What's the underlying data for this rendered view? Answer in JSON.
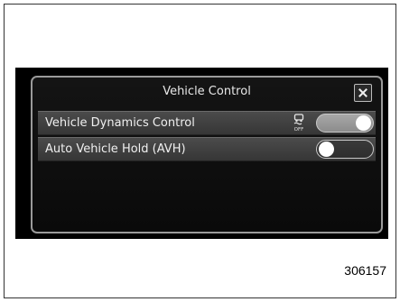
{
  "dialog": {
    "title": "Vehicle Control",
    "close_icon": "close-icon"
  },
  "settings": [
    {
      "label": "Vehicle Dynamics Control",
      "status_icon": "vdc-off-icon",
      "toggle_on": true
    },
    {
      "label": "Auto Vehicle Hold (AVH)",
      "toggle_on": false
    }
  ],
  "figure_number": "306157",
  "colors": {
    "screen_background": "#000000",
    "row_background": "#404040",
    "toggle_on": "#9a9a9a",
    "toggle_off": "#333333"
  }
}
